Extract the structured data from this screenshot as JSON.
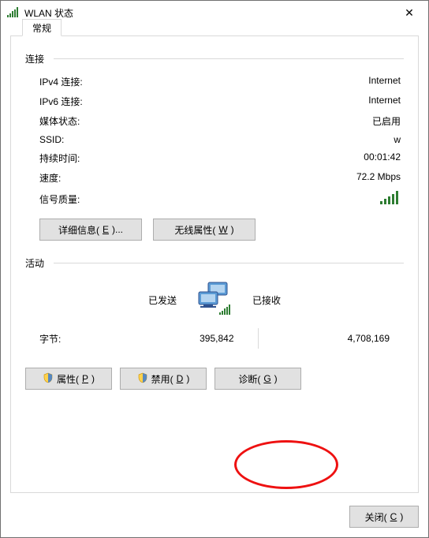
{
  "window": {
    "title": "WLAN 状态",
    "close_glyph": "✕"
  },
  "tab": {
    "general": "常规"
  },
  "groups": {
    "connection": "连接",
    "activity": "活动"
  },
  "connection": {
    "ipv4_label": "IPv4 连接:",
    "ipv4_value": "Internet",
    "ipv6_label": "IPv6 连接:",
    "ipv6_value": "Internet",
    "media_label": "媒体状态:",
    "media_value": "已启用",
    "ssid_label": "SSID:",
    "ssid_value": "w",
    "duration_label": "持续时间:",
    "duration_value": "00:01:42",
    "speed_label": "速度:",
    "speed_value": "72.2 Mbps",
    "signal_label": "信号质量:"
  },
  "buttons": {
    "details_pre": "详细信息(",
    "details_hot": "E",
    "details_post": ")...",
    "wireless_pre": "无线属性(",
    "wireless_hot": "W",
    "wireless_post": ")",
    "properties_pre": "属性(",
    "properties_hot": "P",
    "properties_post": ")",
    "disable_pre": "禁用(",
    "disable_hot": "D",
    "disable_post": ")",
    "diagnose_pre": "诊断(",
    "diagnose_hot": "G",
    "diagnose_post": ")",
    "close_pre": "关闭(",
    "close_hot": "C",
    "close_post": ")"
  },
  "activity": {
    "sent_label": "已发送",
    "recv_label": "已接收",
    "bytes_label": "字节:",
    "sent_bytes": "395,842",
    "recv_bytes": "4,708,169"
  }
}
